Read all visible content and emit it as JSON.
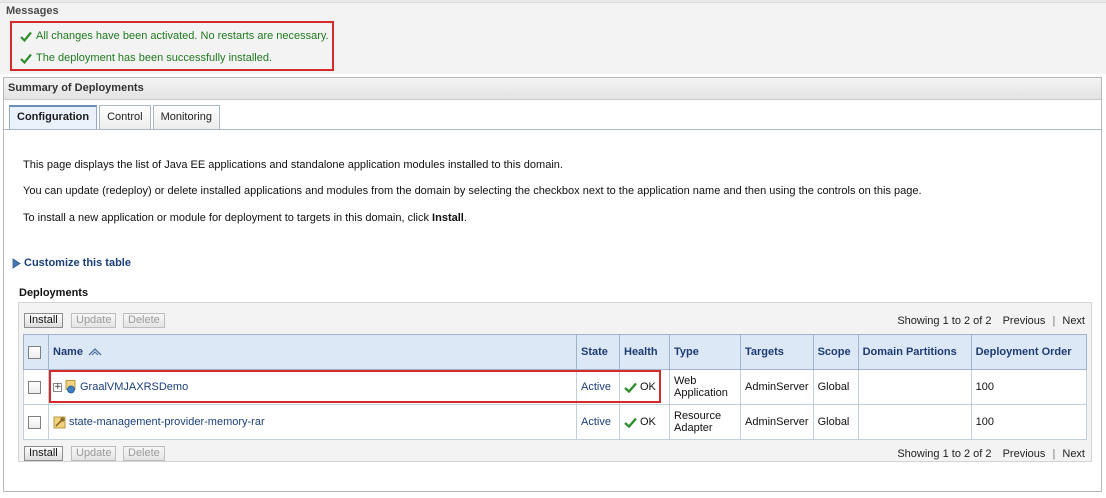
{
  "messages": {
    "title": "Messages",
    "items": [
      "All changes have been activated. No restarts are necessary.",
      "The deployment has been successfully installed."
    ],
    "success_color": "#1f7a1f"
  },
  "summary": {
    "title": "Summary of Deployments",
    "tabs": [
      "Configuration",
      "Control",
      "Monitoring"
    ],
    "active_tab": "Configuration",
    "intro": [
      "This page displays the list of Java EE applications and standalone application modules installed to this domain.",
      "You can update (redeploy) or delete installed applications and modules from the domain by selecting the checkbox next to the application name and then using the controls on this page."
    ],
    "install_prefix": "To install a new application or module for deployment to targets in this domain, click ",
    "install_word": "Install",
    "install_suffix": ".",
    "customize_label": "Customize this table"
  },
  "deployments": {
    "title": "Deployments",
    "buttons": {
      "install": "Install",
      "update": "Update",
      "delete": "Delete"
    },
    "pager": {
      "showing": "Showing 1 to 2 of 2",
      "previous": "Previous",
      "next": "Next"
    },
    "columns": [
      "Name",
      "State",
      "Health",
      "Type",
      "Targets",
      "Scope",
      "Domain Partitions",
      "Deployment Order"
    ],
    "rows": [
      {
        "name": "GraalVMJAXRSDemo",
        "icon": "web-application-icon",
        "state": "Active",
        "health": "OK",
        "type_line1": "Web",
        "type_line2": "Application",
        "targets": "AdminServer",
        "scope": "Global",
        "partitions": "",
        "order": "100"
      },
      {
        "name": "state-management-provider-memory-rar",
        "icon": "resource-adapter-icon",
        "state": "Active",
        "health": "OK",
        "type_line1": "Resource",
        "type_line2": "Adapter",
        "targets": "AdminServer",
        "scope": "Global",
        "partitions": "",
        "order": "100"
      }
    ],
    "highlight_color": "#d42a2a"
  }
}
